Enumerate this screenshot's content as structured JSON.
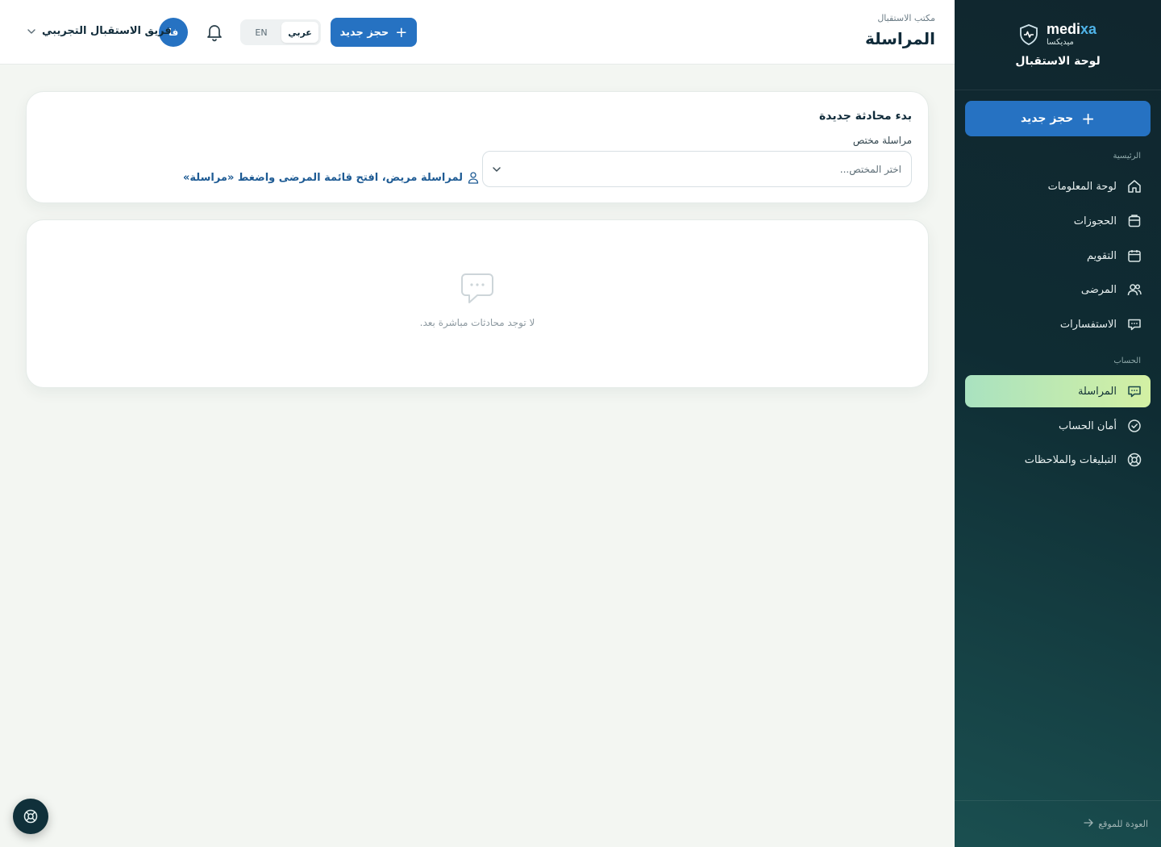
{
  "sidebar": {
    "brand_en_main": "medi",
    "brand_en_accent": "xa",
    "brand_ar": "ميديكسا",
    "subtitle": "لوحة الاستقبال",
    "new_booking": "حجز جديد",
    "section_main": "الرئيسية",
    "section_account": "الحساب",
    "items": [
      {
        "label": "لوحة المعلومات",
        "icon": "home-icon"
      },
      {
        "label": "الحجوزات",
        "icon": "bookings-icon"
      },
      {
        "label": "التقويم",
        "icon": "calendar-icon"
      },
      {
        "label": "المرضى",
        "icon": "patients-icon"
      },
      {
        "label": "الاستفسارات",
        "icon": "chat-icon"
      },
      {
        "label": "المراسلة",
        "icon": "chat-icon",
        "active": true
      },
      {
        "label": "أمان الحساب",
        "icon": "check-circle-icon"
      },
      {
        "label": "التبليغات والملاحظات",
        "icon": "lifebuoy-icon"
      }
    ],
    "back_to_site": "العودة للموقع"
  },
  "topbar": {
    "breadcrumb": "مكتب الاستقبال",
    "title": "المراسلة",
    "new_booking": "حجز جديد",
    "lang_ar": "عربي",
    "lang_en": "EN",
    "avatar_initials": "فا",
    "user_name": "فريق الاستقبال التجريبي"
  },
  "start_chat": {
    "title": "بدء محادثة جديدة",
    "field_label": "مراسلة مختص",
    "select_placeholder": "اختر المختص...",
    "hint": "لمراسلة مريض، افتح قائمة المرضى واضغط «مراسلة»"
  },
  "empty_state": {
    "text": "لا توجد محادثات مباشرة بعد."
  },
  "colors": {
    "primary": "#2672c2",
    "sidebar_dark": "#0f2c33",
    "active_nav_from": "#a9e2c0",
    "active_nav_to": "#d3f0a3"
  }
}
